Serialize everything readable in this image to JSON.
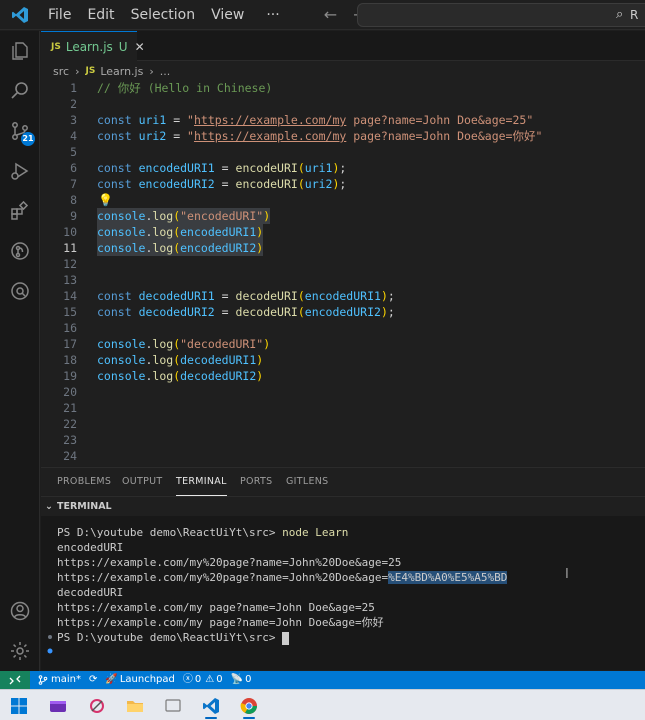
{
  "titlebar": {
    "menu": [
      "File",
      "Edit",
      "Selection",
      "View",
      "···"
    ],
    "search_text": "R"
  },
  "activitybar": {
    "icons": [
      "explorer-icon",
      "search-icon",
      "source-control-icon",
      "run-debug-icon",
      "extensions-icon",
      "gitlens-icon",
      "remote-explorer-icon",
      "account-icon",
      "settings-gear-icon"
    ],
    "source_control_badge": "21"
  },
  "tab": {
    "icon_text": "JS",
    "name": "Learn.js",
    "status": "U",
    "close": "✕"
  },
  "breadcrumb": {
    "folder": "src",
    "sep": "›",
    "icon_text": "JS",
    "file": "Learn.js",
    "more": "..."
  },
  "editor": {
    "line_numbers": [
      "1",
      "2",
      "3",
      "4",
      "5",
      "6",
      "7",
      "8",
      "9",
      "10",
      "11",
      "12",
      "13",
      "14",
      "15",
      "16",
      "17",
      "18",
      "19",
      "20",
      "21",
      "22",
      "23",
      "24"
    ],
    "active_line": "11",
    "code": {
      "l1": "// 你好 (Hello in Chinese)",
      "l3_kw": "const",
      "l3_var": "uri1",
      "l3_eq": " = ",
      "l3_q1": "\"",
      "l3_url": "https://example.com/my",
      "l3_rest": " page?name=John Doe&age=25\"",
      "l4_kw": "const",
      "l4_var": "uri2",
      "l4_eq": " = ",
      "l4_q1": "\"",
      "l4_url": "https://example.com/my",
      "l4_rest": " page?name=John Doe&age=你好\"",
      "l6_kw": "const",
      "l6_var": "encodedURI1",
      "l6_eq": " = ",
      "l6_fn": "encodeURI",
      "l6_open": "(",
      "l6_arg": "uri1",
      "l6_close": ")",
      "l6_semi": ";",
      "l7_kw": "const",
      "l7_var": "encodedURI2",
      "l7_eq": " = ",
      "l7_fn": "encodeURI",
      "l7_open": "(",
      "l7_arg": "uri2",
      "l7_close": ")",
      "l7_semi": ";",
      "bulb": "💡",
      "l9_obj": "console",
      "l9_dot": ".",
      "l9_fn": "log",
      "l9_open": "(",
      "l9_str": "\"encodedURI\"",
      "l9_close": ")",
      "l10_obj": "console",
      "l10_dot": ".",
      "l10_fn": "log",
      "l10_open": "(",
      "l10_arg": "encodedURI1",
      "l10_close": ")",
      "l11_obj": "console",
      "l11_dot": ".",
      "l11_fn": "log",
      "l11_open": "(",
      "l11_arg": "encodedURI2",
      "l11_close": ")",
      "l14_kw": "const",
      "l14_var": "decodedURI1",
      "l14_eq": " = ",
      "l14_fn": "decodeURI",
      "l14_open": "(",
      "l14_arg": "encodedURI1",
      "l14_close": ")",
      "l14_semi": ";",
      "l15_kw": "const",
      "l15_var": "decodedURI2",
      "l15_eq": " = ",
      "l15_fn": "decodeURI",
      "l15_open": "(",
      "l15_arg": "encodedURI2",
      "l15_close": ")",
      "l15_semi": ";",
      "l17_obj": "console",
      "l17_dot": ".",
      "l17_fn": "log",
      "l17_open": "(",
      "l17_str": "\"decodedURI\"",
      "l17_close": ")",
      "l18_obj": "console",
      "l18_dot": ".",
      "l18_fn": "log",
      "l18_open": "(",
      "l18_arg": "decodedURI1",
      "l18_close": ")",
      "l19_obj": "console",
      "l19_dot": ".",
      "l19_fn": "log",
      "l19_open": "(",
      "l19_arg": "decodedURI2",
      "l19_close": ")"
    }
  },
  "panel": {
    "tabs": [
      "PROBLEMS",
      "OUTPUT",
      "TERMINAL",
      "PORTS",
      "GITLENS"
    ],
    "active_tab": "TERMINAL",
    "section_header": "TERMINAL",
    "chevron": "⌄"
  },
  "terminal": {
    "prompt1": "PS D:\\youtube demo\\ReactUiYt\\src> ",
    "cmd1": "node Learn",
    "out1": "encodedURI",
    "out2": "https://example.com/my%20page?name=John%20Doe&age=25",
    "out3_pre": "https://example.com/my%20page?name=John%20Doe&age=",
    "out3_sel": "%E4%BD%A0%E5%A5%BD",
    "out4": "decodedURI",
    "out5": "https://example.com/my page?name=John Doe&age=25",
    "out6": "https://example.com/my page?name=John Doe&age=你好",
    "prompt2": "PS D:\\youtube demo\\ReactUiYt\\src> "
  },
  "statusbar": {
    "branch": "main*",
    "launchpad": "Launchpad",
    "errors": "0",
    "warnings": "0",
    "ports": "0"
  },
  "colors": {
    "accent": "#0078d4",
    "remote": "#16825d",
    "untracked": "#73c991"
  }
}
